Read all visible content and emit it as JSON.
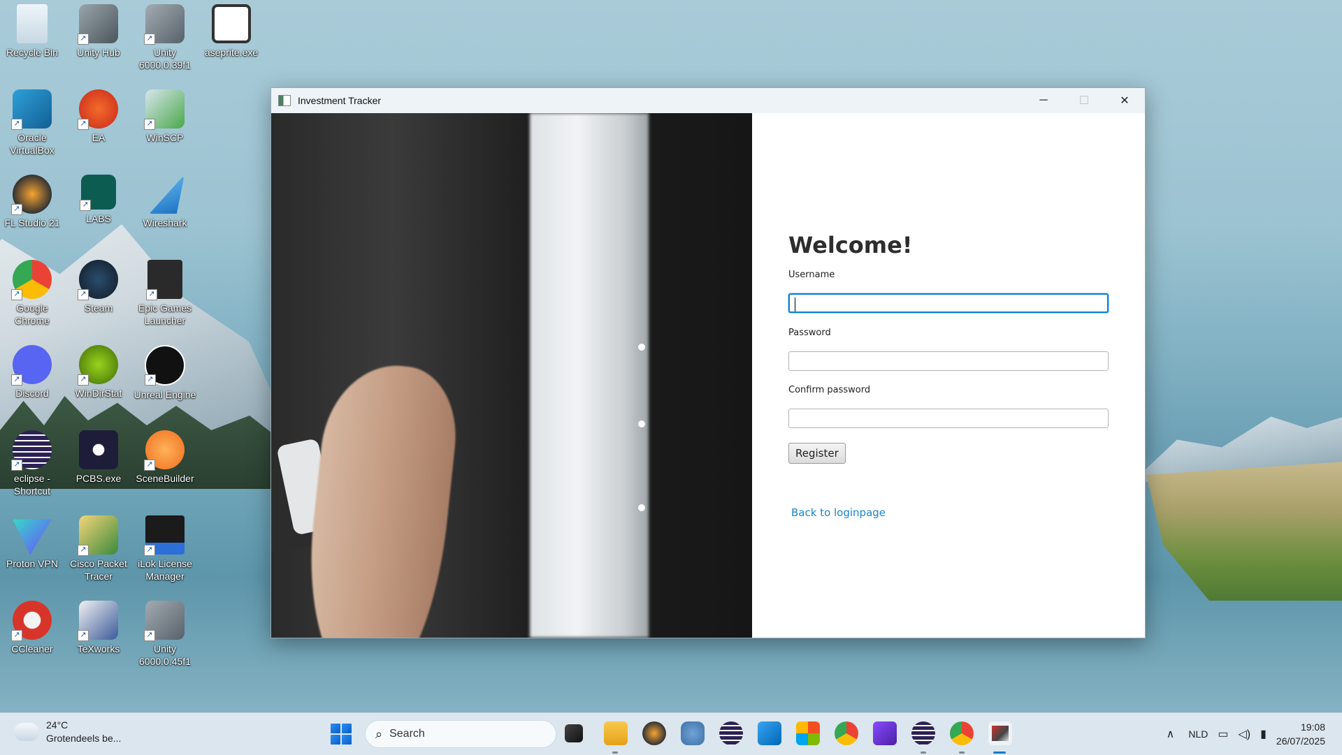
{
  "desktop": {
    "icons": [
      {
        "label": "Recycle Bin",
        "icon": "recycle-bin-icon"
      },
      {
        "label": "Unity Hub",
        "icon": "unity-hub-icon"
      },
      {
        "label": "Unity 6000.0.39f1",
        "icon": "unity-icon"
      },
      {
        "label": "aseprite.exe",
        "icon": "aseprite-icon"
      },
      {
        "label": "Oracle VirtualBox",
        "icon": "virtualbox-icon"
      },
      {
        "label": "EA",
        "icon": "ea-icon"
      },
      {
        "label": "WinSCP",
        "icon": "winscp-icon"
      },
      {
        "label": "FL Studio 21",
        "icon": "fl-studio-icon"
      },
      {
        "label": "LABS",
        "icon": "labs-icon"
      },
      {
        "label": "Wireshark",
        "icon": "wireshark-icon"
      },
      {
        "label": "Google Chrome",
        "icon": "chrome-icon"
      },
      {
        "label": "Steam",
        "icon": "steam-icon"
      },
      {
        "label": "Epic Games Launcher",
        "icon": "epic-games-icon"
      },
      {
        "label": "Discord",
        "icon": "discord-icon"
      },
      {
        "label": "WinDirStat",
        "icon": "windirstat-icon"
      },
      {
        "label": "Unreal Engine",
        "icon": "unreal-engine-icon"
      },
      {
        "label": "eclipse - Shortcut",
        "icon": "eclipse-icon"
      },
      {
        "label": "PCBS.exe",
        "icon": "pcbs-icon"
      },
      {
        "label": "SceneBuilder",
        "icon": "scenebuilder-icon"
      },
      {
        "label": "Proton VPN",
        "icon": "proton-vpn-icon"
      },
      {
        "label": "Cisco Packet Tracer",
        "icon": "packet-tracer-icon"
      },
      {
        "label": "iLok License Manager",
        "icon": "ilok-icon"
      },
      {
        "label": "CCleaner",
        "icon": "ccleaner-icon"
      },
      {
        "label": "TeXworks",
        "icon": "texworks-icon"
      },
      {
        "label": "Unity 6000.0.45f1",
        "icon": "unity-icon"
      }
    ],
    "icon_labels": {
      "recycle_bin": "Recycle Bin",
      "unity_hub": "Unity Hub",
      "unity_39": "Unity 6000.0.39f1",
      "aseprite": "aseprite.exe",
      "virtualbox": "Oracle VirtualBox",
      "ea": "EA",
      "winscp": "WinSCP",
      "fl_studio": "FL Studio 21",
      "labs": "LABS",
      "wireshark": "Wireshark",
      "chrome": "Google Chrome",
      "steam": "Steam",
      "epic": "Epic Games Launcher",
      "discord": "Discord",
      "windirstat": "WinDirStat",
      "unreal": "Unreal Engine",
      "eclipse": "eclipse - Shortcut",
      "pcbs": "PCBS.exe",
      "scenebuilder": "SceneBuilder",
      "proton": "Proton VPN",
      "packet_tracer": "Cisco Packet Tracer",
      "ilok": "iLok License Manager",
      "ccleaner": "CCleaner",
      "texworks": "TeXworks",
      "unity_45": "Unity 6000.0.45f1"
    },
    "icon_colors": {
      "ea": "#e8461f",
      "labs": "#0d5c52",
      "chrome": "#4285f4",
      "steam": "#1b2838",
      "epic": "#2a2a2a",
      "discord": "#5865f2",
      "windirstat": "#7cb518",
      "unreal": "#111111",
      "eclipse": "#2c2255",
      "pcbs": "#1d1d3a",
      "scenebuilder": "#f28b1e",
      "proton": "#6d4aff",
      "ilok": "#1b1b1b",
      "ccleaner": "#d8352a",
      "virtualbox": "#1c7bbd",
      "wireshark": "#1a7bd6"
    }
  },
  "window": {
    "title": "Investment Tracker",
    "minimize": "─",
    "maximize": "☐",
    "close": "✕"
  },
  "form": {
    "heading": "Welcome!",
    "username_label": "Username",
    "username_value": "",
    "password_label": "Password",
    "password_value": "",
    "confirm_label": "Confirm password",
    "confirm_value": "",
    "register_button": "Register",
    "back_link": "Back to loginpage"
  },
  "taskbar": {
    "weather_temp": "24°C",
    "weather_desc": "Grotendeels be...",
    "search_placeholder": "Search",
    "apps": [
      "file-explorer-icon",
      "fl-studio-icon",
      "godot-icon",
      "eclipse-icon",
      "vscode-icon",
      "microsoft-365-icon",
      "chrome-icon",
      "proton-pass-icon",
      "eclipse-icon",
      "chrome-icon",
      "investment-tracker-icon"
    ],
    "language": "NLD",
    "time": "19:08",
    "date": "26/07/2025",
    "colors": {
      "accent": "#0d7bd0"
    }
  }
}
